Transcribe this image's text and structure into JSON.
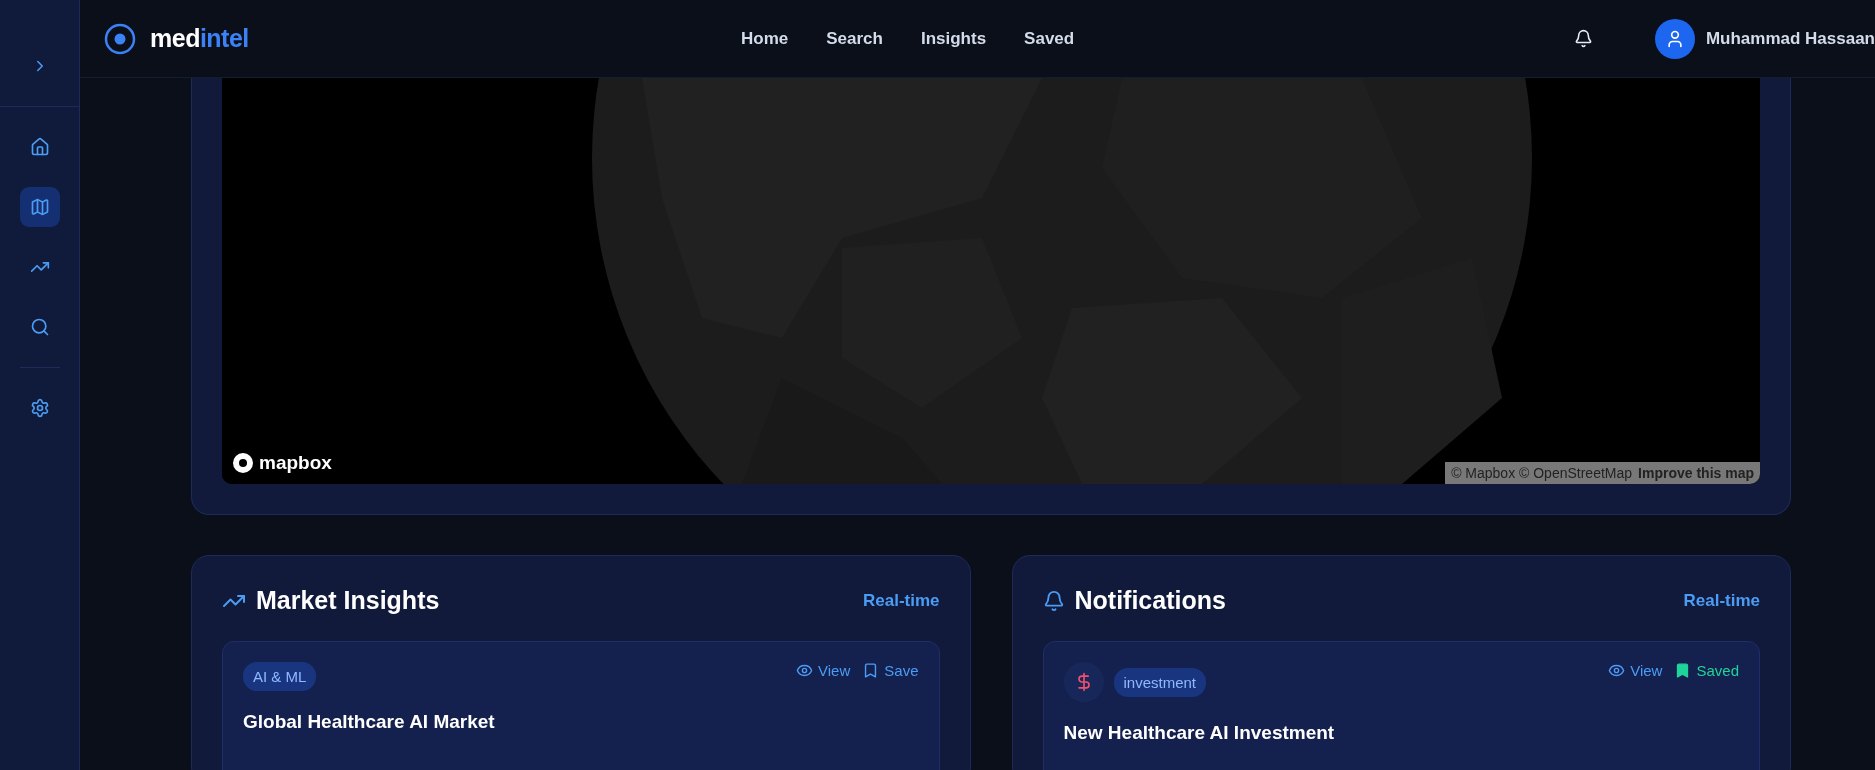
{
  "sidebar": {
    "items": [
      {
        "kind": "home",
        "selected": false
      },
      {
        "kind": "map",
        "selected": true
      },
      {
        "kind": "trend",
        "selected": false
      },
      {
        "kind": "search",
        "selected": false
      },
      {
        "kind": "settings",
        "selected": false
      }
    ]
  },
  "header": {
    "logo": {
      "first": "med",
      "second": "intel"
    },
    "nav": [
      {
        "label": "Home"
      },
      {
        "label": "Search"
      },
      {
        "label": "Insights"
      },
      {
        "label": "Saved"
      }
    ],
    "user": {
      "name": "Muhammad Hassaan"
    }
  },
  "map": {
    "kind": "picture",
    "logo": "mapbox",
    "credits": "© Mapbox © OpenStreetMap",
    "link": "Improve this map"
  },
  "panels": [
    {
      "kind": "trend",
      "title": "Market Insights",
      "badge": "Real-time",
      "items": [
        {
          "kind": "plain",
          "tag": "AI & ML",
          "title": "Global Healthcare AI Market",
          "actions": [
            {
              "kind": "view",
              "label": "View",
              "on": false
            },
            {
              "kind": "save",
              "label": "Save",
              "on": false
            }
          ]
        }
      ]
    },
    {
      "kind": "bell",
      "title": "Notifications",
      "badge": "Real-time",
      "items": [
        {
          "kind": "finance",
          "tag": "investment",
          "title": "New Healthcare AI Investment",
          "actions": [
            {
              "kind": "view",
              "label": "View",
              "on": false
            },
            {
              "kind": "save",
              "label": "Saved",
              "on": true
            }
          ]
        }
      ]
    }
  ]
}
